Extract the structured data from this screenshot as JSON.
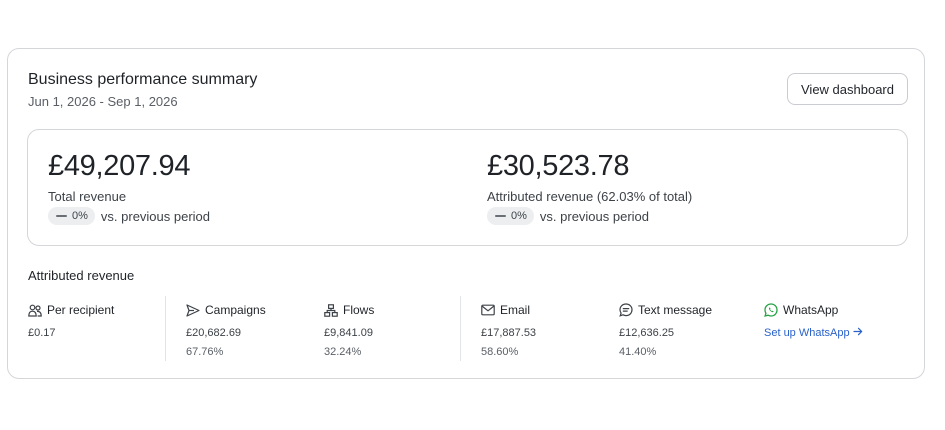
{
  "summary": {
    "title": "Business performance summary",
    "date_range": "Jun 1, 2026 - Sep 1, 2026",
    "view_button": "View dashboard"
  },
  "metrics": {
    "total": {
      "value": "£49,207.94",
      "label": "Total revenue",
      "change": "0%",
      "change_suffix": "vs. previous period"
    },
    "attributed": {
      "value": "£30,523.78",
      "label": "Attributed revenue (62.03% of total)",
      "change": "0%",
      "change_suffix": "vs. previous period"
    }
  },
  "attributed_section": {
    "title": "Attributed revenue",
    "columns": [
      {
        "name": "Per recipient",
        "icon": "people-icon",
        "value": "£0.17",
        "percent": ""
      },
      {
        "name": "Campaigns",
        "icon": "send-icon",
        "value": "£20,682.69",
        "percent": "67.76%"
      },
      {
        "name": "Flows",
        "icon": "flow-icon",
        "value": "£9,841.09",
        "percent": "32.24%"
      },
      {
        "name": "Email",
        "icon": "envelope-icon",
        "value": "£17,887.53",
        "percent": "58.60%"
      },
      {
        "name": "Text message",
        "icon": "chat-icon",
        "value": "£12,636.25",
        "percent": "41.40%"
      },
      {
        "name": "WhatsApp",
        "icon": "whatsapp-icon",
        "link": "Set up WhatsApp",
        "link_color": "#2a62c9",
        "icon_color": "#25a244"
      }
    ]
  }
}
